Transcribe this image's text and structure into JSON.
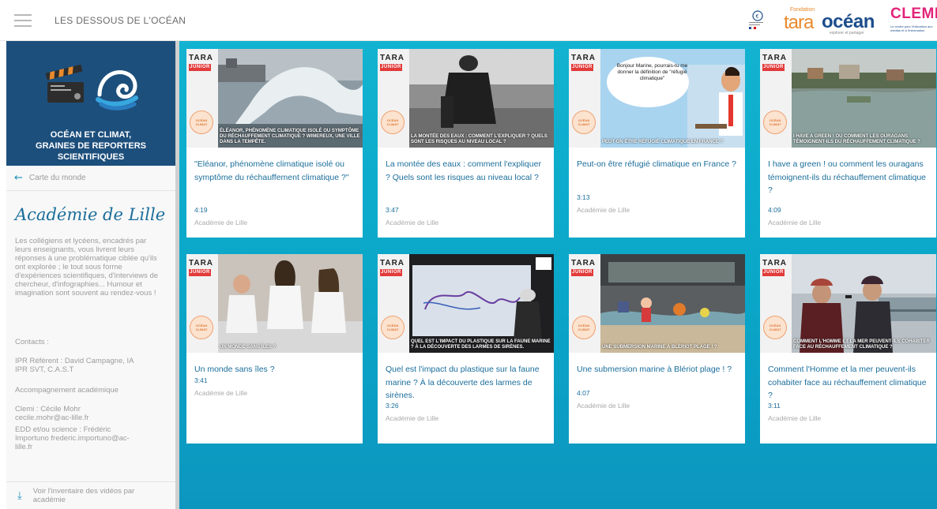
{
  "header": {
    "site_title": "LES DESSOUS DE L'OCÉAN",
    "tara_small": "Fondation",
    "tara_word": "tara",
    "ocean_word": "océan",
    "tara_sub": "explorer et partager",
    "clemi_word": "CLEMI",
    "clemi_sub": "Le centre pour l'éducation aux médias et à l'information"
  },
  "sidebar": {
    "banner_title_line1": "OCÉAN ET CLIMAT,",
    "banner_title_line2": "GRAINES DE REPORTERS SCIENTIFIQUES",
    "back_label": "Carte du monde",
    "academie": "Académie de Lille",
    "description": "Les collégiens et lycéens, encadrés par leurs enseignants, vous livrent leurs réponses à une problématique ciblée qu'ils ont explorée ; le tout sous forme d'expériences scientifiques, d'interviews de chercheur, d'infographies... Humour et imagination sont souvent au rendez-vous !",
    "contacts_label": "Contacts :",
    "ipr": "IPR Référent : David Campagne, IA IPR SVT, C.A.S.T",
    "accompagnement": "Accompagnement académique",
    "clemi_contact": "Clemi : Cécile Mohr cecile.mohr@ac-lille.fr",
    "edd_contact": "EDD et/ou science : Frédéric Importuno frederic.importuno@ac-lille.fr",
    "inventory": "Voir l'inventaire des vidéos par académie"
  },
  "thumb": {
    "tara": "TARA",
    "junior": "JUNIOR",
    "stamp": "OCÉAN CLIMAT"
  },
  "cards": [
    {
      "caption": "ÉLÉANOR, PHÉNOMÈNE CLIMATIQUE ISOLÉ OU SYMPTÔME DU RÉCHAUFFEMENT CLIMATIQUE ? WIMEREUX, UNE VILLE DANS LA TEMPÊTE.",
      "title": "\"Eléanor, phénomène climatique isolé ou symptôme du réchauffement climatique ?\"",
      "duration": "4:19",
      "source": "Académie de Lille"
    },
    {
      "caption": "LA MONTÉE DES EAUX : COMMENT L'EXPLIQUER ? QUELS SONT LES RISQUES AU NIVEAU LOCAL ?",
      "title": "La montée des eaux : comment l'expliquer ? Quels sont les risques au niveau local ?",
      "duration": "3:47",
      "source": "Académie de Lille"
    },
    {
      "caption": "PEUT-ON ÊTRE RÉFUGIÉ CLIMATIQUE EN FRANCE ?",
      "title": "Peut-on être réfugié climatique en France ?",
      "duration": "3:13",
      "source": "Académie de Lille",
      "bubble": "Bonjour Marine, pourrais-tu me donner la définition de \"réfugié climatique\""
    },
    {
      "caption": "I HAVE A GREEN ! OU COMMENT LES OURAGANS TÉMOIGNENT-ILS DU RÉCHAUFFEMENT CLIMATIQUE ?",
      "title": "I have a green ! ou comment les ouragans témoignent-ils du réchauffement climatique ?",
      "duration": "4:09",
      "source": "Académie de Lille"
    },
    {
      "caption": "UN MONDE SANS ÎLES ?",
      "title": "Un monde sans îles ?",
      "duration": "3:41",
      "source": "Académie de Lille"
    },
    {
      "caption": "QUEL EST L'IMPACT DU PLASTIQUE SUR LA FAUNE MARINE ? À LA DÉCOUVERTE DES LARMES DE SIRÈNES.",
      "title": "Quel est l'impact du plastique sur la faune marine ? À la découverte des larmes de sirènes.",
      "duration": "3:26",
      "source": "Académie de Lille"
    },
    {
      "caption": "UNE SUBMERSION MARINE À BLÉRIOT PLAGE ! ?",
      "title": "Une submersion marine à Blériot plage ! ?",
      "duration": "4:07",
      "source": "Académie de Lille"
    },
    {
      "caption": "COMMENT L'HOMME ET LA MER PEUVENT-ILS COHABITER FACE AU RÉCHAUFFEMENT CLIMATIQUE ?",
      "title": "Comment l'Homme et la mer peuvent-ils cohabiter face au réchauffement climatique ?",
      "duration": "3:11",
      "source": "Académie de Lille"
    }
  ],
  "colors": {
    "accent": "#1b6e9b",
    "banner": "#1d4f7c",
    "content_bg": "#0aa6c8",
    "tara_orange": "#e88a2d",
    "clemi_pink": "#e2237a"
  }
}
